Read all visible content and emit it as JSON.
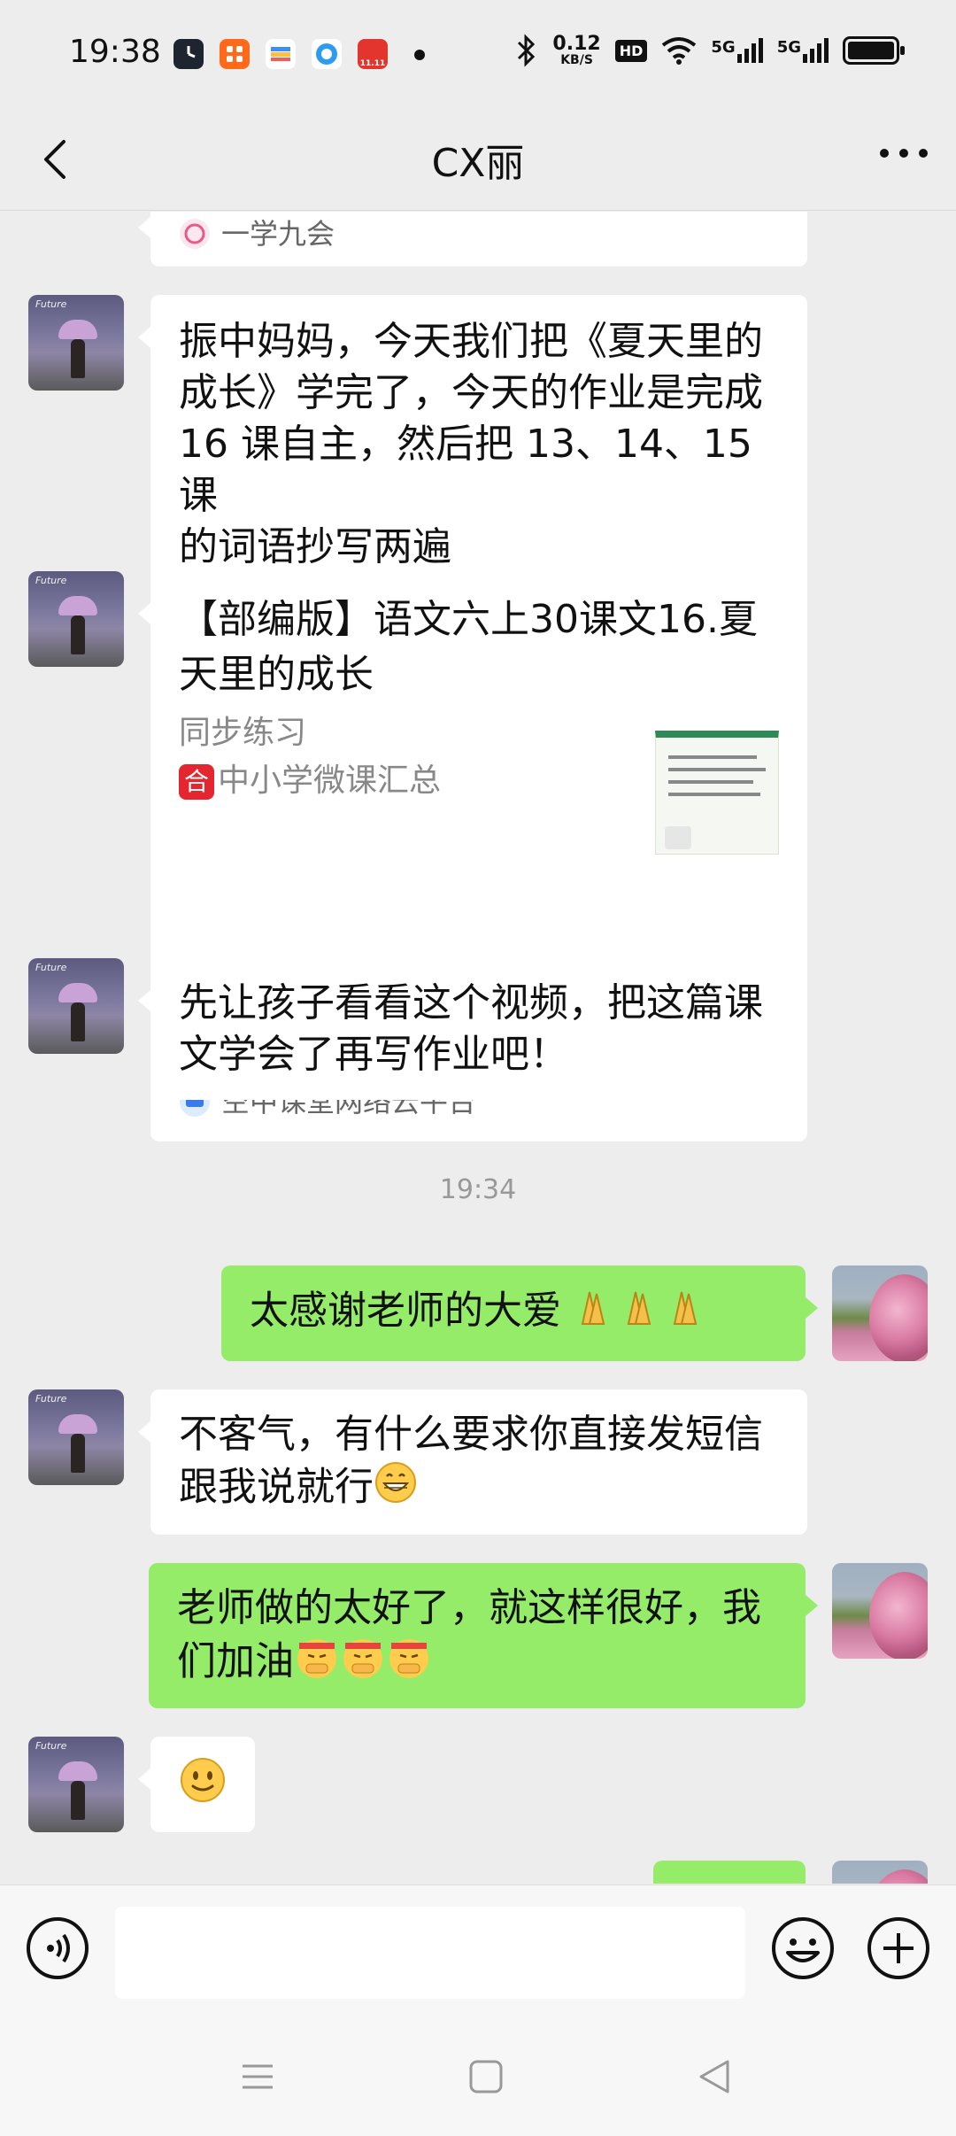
{
  "status_bar": {
    "time": "19:38",
    "net_speed_value": "0.12",
    "net_speed_unit": "KB/S",
    "hd_label": "HD",
    "signal1": "5G",
    "signal2": "5G",
    "app_icon_badge": "11.11",
    "icons": [
      "clock-app-icon",
      "orange-app-icon",
      "wallet-app-icon",
      "browser-app-icon",
      "shop-app-icon",
      "bluetooth-icon",
      "wifi-icon",
      "battery-icon"
    ]
  },
  "nav": {
    "title": "CX丽",
    "back_icon": "chevron-left-icon",
    "more_icon": "more-dots-icon"
  },
  "messages": [
    {
      "type": "source-footer",
      "side": "left",
      "source": "一学九会"
    },
    {
      "type": "text",
      "side": "left",
      "text_lines": [
        "振中妈妈，今天我们把《夏天里的",
        "成长》学完了，今天的作业是完成",
        "16 课自主，然后把 13、14、15 课",
        "的词语抄写两遍"
      ]
    },
    {
      "type": "card",
      "side": "left",
      "title_lines": [
        "【部编版】语文六上30课文16.夏",
        "天里的成长"
      ],
      "desc_line1": "同步练习",
      "desc_badge": "合",
      "desc_line2": "中小学微课汇总",
      "source": "空中课堂网络云平台"
    },
    {
      "type": "text",
      "side": "left",
      "text_lines": [
        "先让孩子看看这个视频，把这篇课",
        "文学会了再写作业吧！"
      ]
    },
    {
      "type": "timestamp",
      "text": "19:34"
    },
    {
      "type": "text",
      "side": "right",
      "text": "太感谢老师的大爱",
      "emoji": "folded-hands-emoji x3"
    },
    {
      "type": "text",
      "side": "left",
      "text_lines": [
        "不客气，有什么要求你直接发短信",
        "跟我说就行"
      ],
      "emoji": "grinning-emoji"
    },
    {
      "type": "text",
      "side": "right",
      "text_lines": [
        "老师做的太好了，就这样很好，我",
        "们加油"
      ],
      "emoji": "determined-face-emoji x3"
    },
    {
      "type": "emoji",
      "side": "left",
      "emoji": "slight-smile-emoji"
    }
  ],
  "input_bar": {
    "voice_icon": "voice-icon",
    "emoji_icon": "emoji-icon",
    "plus_icon": "plus-icon",
    "text_value": ""
  },
  "system_nav": {
    "icons": [
      "menu-icon",
      "home-icon",
      "back-triangle-icon"
    ]
  },
  "colors": {
    "background": "#EDEDED",
    "bubble_self": "#95EC69",
    "bubble_other": "#FFFFFF",
    "timestamp": "#999999"
  }
}
